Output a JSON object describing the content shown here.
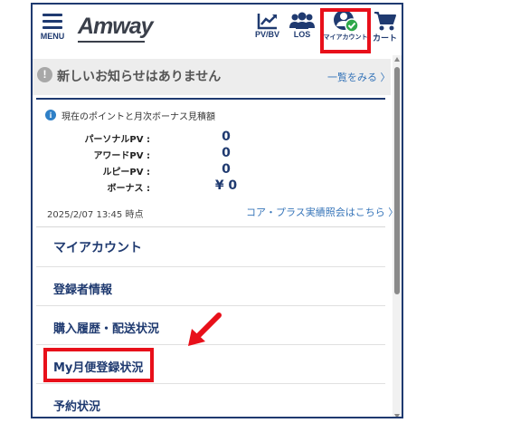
{
  "header": {
    "menu_label": "MENU",
    "logo_text": "Amway",
    "pvbv_label": "PV/BV",
    "los_label": "LOS",
    "account_label": "マイアカウント",
    "cart_label": "カート"
  },
  "notice": {
    "text": "新しいお知らせはありません",
    "link": "一覧をみる 〉"
  },
  "points": {
    "heading": "現在のポイントと月次ボーナス見積額",
    "rows": [
      {
        "label": "パーソナルPV :",
        "value": "0"
      },
      {
        "label": "アワードPV :",
        "value": "0"
      },
      {
        "label": "ルピーPV :",
        "value": "0"
      },
      {
        "label": "ボーナス :",
        "value": "¥ 0"
      }
    ],
    "timestamp": "2025/2/07 13:45 時点",
    "core_link": "コア・プラス実績照会はこちら 〉"
  },
  "menu": {
    "title": "マイアカウント",
    "items": [
      "登録者情報",
      "購入履歴・配送状況",
      "My月便登録状況",
      "予約状況"
    ]
  },
  "colors": {
    "navy": "#1f3a70",
    "link": "#3775b9",
    "highlight": "#e8101a",
    "check": "#2ea84a"
  }
}
